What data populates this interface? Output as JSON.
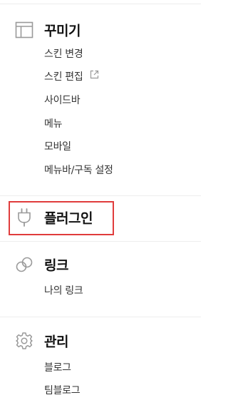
{
  "sections": [
    {
      "title": "꾸미기",
      "icon": "layout-icon",
      "items": [
        {
          "label": "스킨 변경",
          "external": false
        },
        {
          "label": "스킨 편집",
          "external": true
        },
        {
          "label": "사이드바",
          "external": false
        },
        {
          "label": "메뉴",
          "external": false
        },
        {
          "label": "모바일",
          "external": false
        },
        {
          "label": "메뉴바/구독 설정",
          "external": false
        }
      ]
    },
    {
      "title": "플러그인",
      "icon": "plug-icon",
      "highlighted": true,
      "items": []
    },
    {
      "title": "링크",
      "icon": "link-icon",
      "items": [
        {
          "label": "나의 링크",
          "external": false
        }
      ]
    },
    {
      "title": "관리",
      "icon": "gear-icon",
      "items": [
        {
          "label": "블로그",
          "external": false
        },
        {
          "label": "팀블로그",
          "external": false
        }
      ]
    }
  ],
  "colors": {
    "highlight_border": "#e03c3c",
    "divider": "#ededed",
    "icon_stroke": "#9a9a9a"
  }
}
